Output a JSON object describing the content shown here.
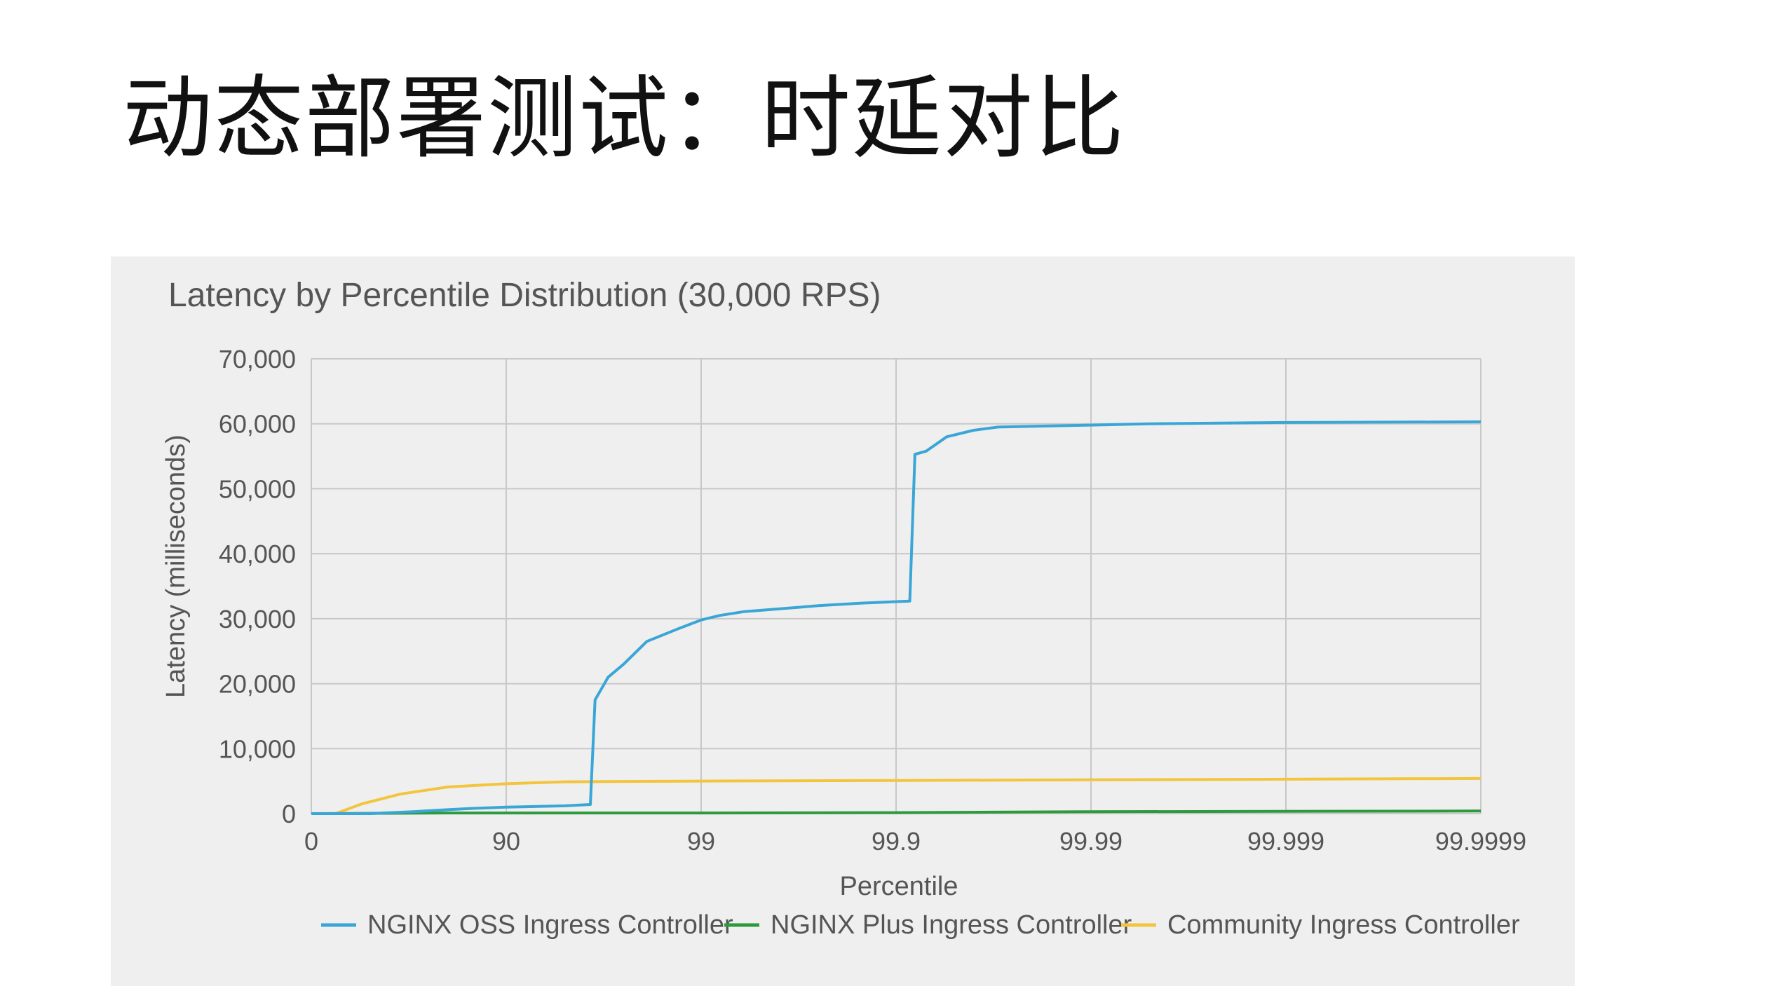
{
  "slide": {
    "title": "动态部署测试：时延对比"
  },
  "colors": {
    "oss": "#3aa6d6",
    "plus": "#2e9a3e",
    "community": "#f2c53d",
    "background": "#efefef"
  },
  "chart_data": {
    "type": "line",
    "title": "Latency by Percentile Distribution (30,000 RPS)",
    "xlabel": "Percentile",
    "ylabel": "Latency (milliseconds)",
    "x_scale": "reciprocal percentile (log of 1/(1-p))",
    "x_ticks": [
      "0",
      "90",
      "99",
      "99.9",
      "99.99",
      "99.999",
      "99.9999"
    ],
    "y_ticks": [
      "0",
      "10,000",
      "20,000",
      "30,000",
      "40,000",
      "50,000",
      "60,000",
      "70,000"
    ],
    "ylim": [
      0,
      70000
    ],
    "grid": true,
    "legend_position": "bottom",
    "series": [
      {
        "name": "NGINX OSS Ingress Controller",
        "color": "#3aa6d6",
        "points": [
          [
            0,
            0
          ],
          [
            50,
            0
          ],
          [
            70,
            300
          ],
          [
            80,
            600
          ],
          [
            85,
            800
          ],
          [
            90,
            1000
          ],
          [
            95,
            1200
          ],
          [
            96.3,
            1400
          ],
          [
            96.5,
            17500
          ],
          [
            97,
            21000
          ],
          [
            97.5,
            23000
          ],
          [
            98.1,
            26500
          ],
          [
            98.7,
            28500
          ],
          [
            99,
            29800
          ],
          [
            99.2,
            30500
          ],
          [
            99.4,
            31100
          ],
          [
            99.6,
            31500
          ],
          [
            99.75,
            32000
          ],
          [
            99.85,
            32400
          ],
          [
            99.915,
            32700
          ],
          [
            99.92,
            55300
          ],
          [
            99.93,
            55800
          ],
          [
            99.945,
            58000
          ],
          [
            99.96,
            59000
          ],
          [
            99.97,
            59500
          ],
          [
            99.99,
            59800
          ],
          [
            99.995,
            60000
          ],
          [
            99.999,
            60200
          ],
          [
            99.9999,
            60300
          ]
        ]
      },
      {
        "name": "NGINX Plus Ingress Controller",
        "color": "#2e9a3e",
        "points": [
          [
            0,
            0
          ],
          [
            80,
            100
          ],
          [
            99,
            100
          ],
          [
            99.9,
            150
          ],
          [
            99.99,
            300
          ],
          [
            99.999,
            350
          ],
          [
            99.9999,
            400
          ]
        ]
      },
      {
        "name": "Community Ingress Controller",
        "color": "#f2c53d",
        "points": [
          [
            0,
            0
          ],
          [
            25,
            0
          ],
          [
            45,
            1500
          ],
          [
            65,
            3000
          ],
          [
            80,
            4100
          ],
          [
            90,
            4600
          ],
          [
            95,
            4900
          ],
          [
            99,
            5000
          ],
          [
            99.9,
            5100
          ],
          [
            99.99,
            5200
          ],
          [
            99.999,
            5300
          ],
          [
            99.9999,
            5400
          ]
        ]
      }
    ]
  }
}
